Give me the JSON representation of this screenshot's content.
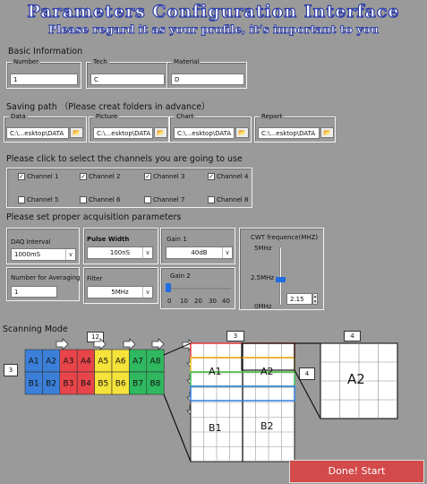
{
  "header": {
    "title": "Parameters Configuration Interface",
    "subtitle": "Please regard it as your profile, it’s important to you"
  },
  "basic": {
    "heading": "Basic Information",
    "number_label": "Number",
    "number_value": "1",
    "tech_label": "Tech",
    "tech_value": "C",
    "material_label": "Material",
    "material_value": "D"
  },
  "saving": {
    "heading": "Saving path （Please creat folders in advance）",
    "data_label": "Data",
    "data_value": "C:\\...esktop\\DATA",
    "picture_label": "Picture",
    "picture_value": "C:\\...esktop\\DATA",
    "chart_label": "Chart",
    "chart_value": "C:\\...esktop\\DATA",
    "report_label": "Report",
    "report_value": "C:\\...esktop\\DATA",
    "folder_glyph": "📂"
  },
  "channels": {
    "heading": "Please click to select the channels you are going to use",
    "items": [
      {
        "label": "Channel 1",
        "checked": true,
        "mark": "✓"
      },
      {
        "label": "Channel 2",
        "checked": true,
        "mark": "✓"
      },
      {
        "label": "Channel 3",
        "checked": true,
        "mark": "✓"
      },
      {
        "label": "Channel 4",
        "checked": true,
        "mark": "✓"
      },
      {
        "label": "Channel 5",
        "checked": false,
        "mark": ""
      },
      {
        "label": "Channel 6",
        "checked": false,
        "mark": ""
      },
      {
        "label": "Channel 7",
        "checked": false,
        "mark": ""
      },
      {
        "label": "Channel 8",
        "checked": false,
        "mark": ""
      }
    ]
  },
  "acq": {
    "heading": "Please set proper acquisition parameters",
    "daq_label": "DAQ Interval",
    "daq_value": "1000mS",
    "avg_label": "Number for Averaging",
    "avg_value": "1",
    "pulse_label": "Pulse Width",
    "pulse_value": "100nS",
    "filter_label": "Filter",
    "filter_value": "5MHz",
    "gain1_label": "Gain 1",
    "gain1_value": "40dB",
    "gain2_label": "Gain 2",
    "gain2_ticks": [
      "0",
      "10",
      "20",
      "30",
      "40"
    ],
    "gain2_level": 0,
    "cwt_label": "CWT  frequence(MHZ)",
    "cwt_ticks": [
      "5MHz",
      "2.5MHz",
      "0MHz"
    ],
    "cwt_value": "2.15",
    "cwt_level": 0.43,
    "arrow_glyph": "∨"
  },
  "scanning": {
    "heading": "Scanning Mode",
    "top_cells": [
      "A1",
      "A2",
      "A3",
      "A4",
      "A5",
      "A6",
      "A7",
      "A8"
    ],
    "bottom_cells": [
      "B1",
      "B2",
      "B3",
      "B4",
      "B5",
      "B6",
      "B7",
      "B8"
    ],
    "label_width": "12",
    "label_height": "3",
    "grid_width": "3",
    "zoom_height": "4",
    "zoom_width": "4",
    "grid_a1": "A1",
    "grid_a2": "A2",
    "grid_b1": "B1",
    "grid_b2": "B2",
    "zoom_label": "A2",
    "cell_colors": [
      "#3b7fd8",
      "#e8454a",
      "#f5e23a",
      "#2fb85f"
    ]
  },
  "footer": {
    "start_label": "Done! Start"
  }
}
